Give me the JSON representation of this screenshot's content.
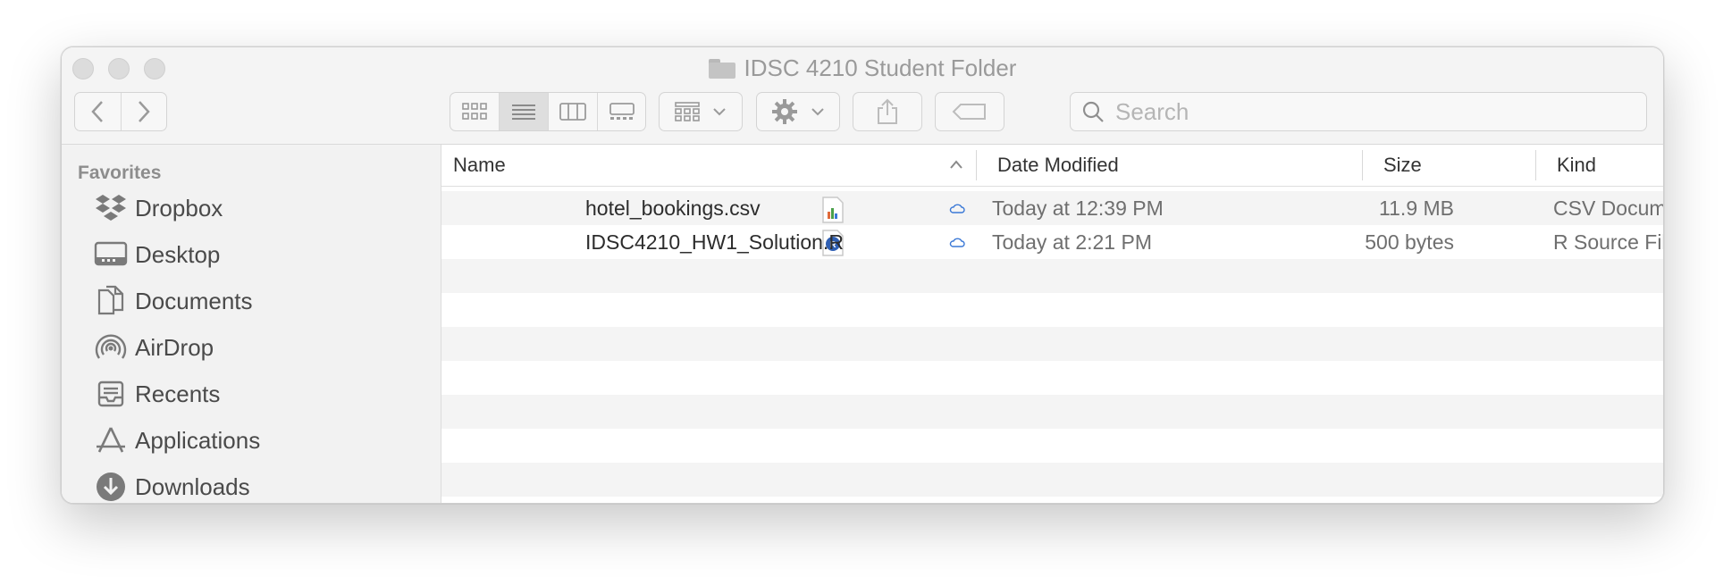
{
  "window": {
    "title": "IDSC 4210 Student Folder"
  },
  "toolbar": {
    "search_placeholder": "Search"
  },
  "sidebar": {
    "heading": "Favorites",
    "items": [
      {
        "label": "Dropbox",
        "icon": "dropbox-icon"
      },
      {
        "label": "Desktop",
        "icon": "desktop-icon"
      },
      {
        "label": "Documents",
        "icon": "documents-icon"
      },
      {
        "label": "AirDrop",
        "icon": "airdrop-icon"
      },
      {
        "label": "Recents",
        "icon": "recents-icon"
      },
      {
        "label": "Applications",
        "icon": "applications-icon"
      },
      {
        "label": "Downloads",
        "icon": "downloads-icon"
      }
    ]
  },
  "columns": {
    "name": "Name",
    "date": "Date Modified",
    "size": "Size",
    "kind": "Kind"
  },
  "files": [
    {
      "name": "hotel_bookings.csv",
      "date": "Today at 12:39 PM",
      "size": "11.9 MB",
      "kind": "CSV Document"
    },
    {
      "name": "IDSC4210_HW1_Solution.R",
      "date": "Today at 2:21 PM",
      "size": "500 bytes",
      "kind": "R Source File"
    }
  ],
  "colors": {
    "icloud": "#3a78d6"
  }
}
